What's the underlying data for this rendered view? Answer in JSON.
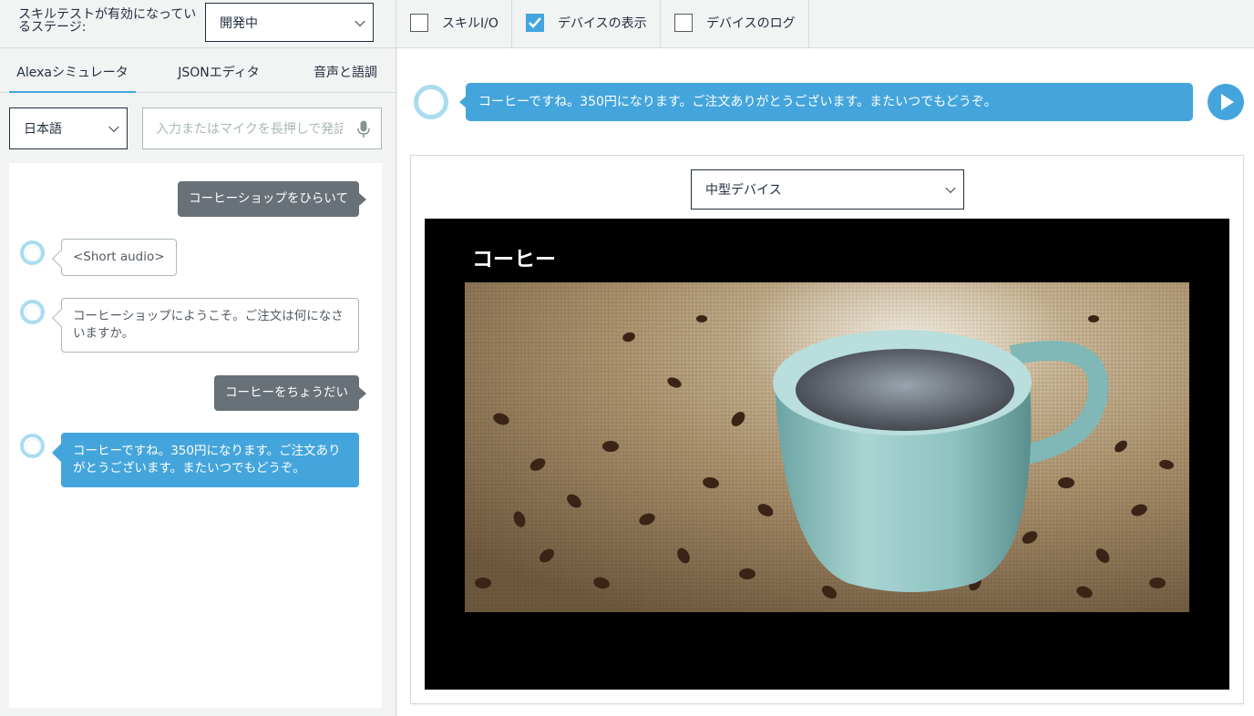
{
  "toolbar": {
    "stage_label": "スキルテストが有効になっているステージ:",
    "stage_value": "開発中",
    "options": [
      {
        "label": "スキルI/O",
        "checked": false
      },
      {
        "label": "デバイスの表示",
        "checked": true
      },
      {
        "label": "デバイスのログ",
        "checked": false
      }
    ]
  },
  "tabs": [
    {
      "label": "Alexaシミュレータ",
      "active": true
    },
    {
      "label": "JSONエディタ",
      "active": false
    },
    {
      "label": "音声と語調",
      "active": false
    }
  ],
  "input": {
    "language": "日本語",
    "placeholder": "入力またはマイクを長押しで発話"
  },
  "conversation": [
    {
      "speaker": "user",
      "text": "コーヒーショップをひらいて"
    },
    {
      "speaker": "alexa",
      "text": "<Short audio>"
    },
    {
      "speaker": "alexa",
      "text": "コーヒーショップにようこそ。ご注文は何になさいますか。"
    },
    {
      "speaker": "user",
      "text": "コーヒーをちょうだい"
    },
    {
      "speaker": "alexa",
      "text": "コーヒーですね。350円になります。ご注文ありがとうございます。またいつでもどうぞ。",
      "selected": true
    }
  ],
  "output": {
    "speech": "コーヒーですね。350円になります。ご注文ありがとうございます。またいつでもどうぞ。"
  },
  "device": {
    "selected": "中型デバイス",
    "screen_title": "コーヒー"
  },
  "colors": {
    "accent": "#44a5dc",
    "user_bubble": "#687078",
    "alexa_ring": "#a9dcef"
  }
}
